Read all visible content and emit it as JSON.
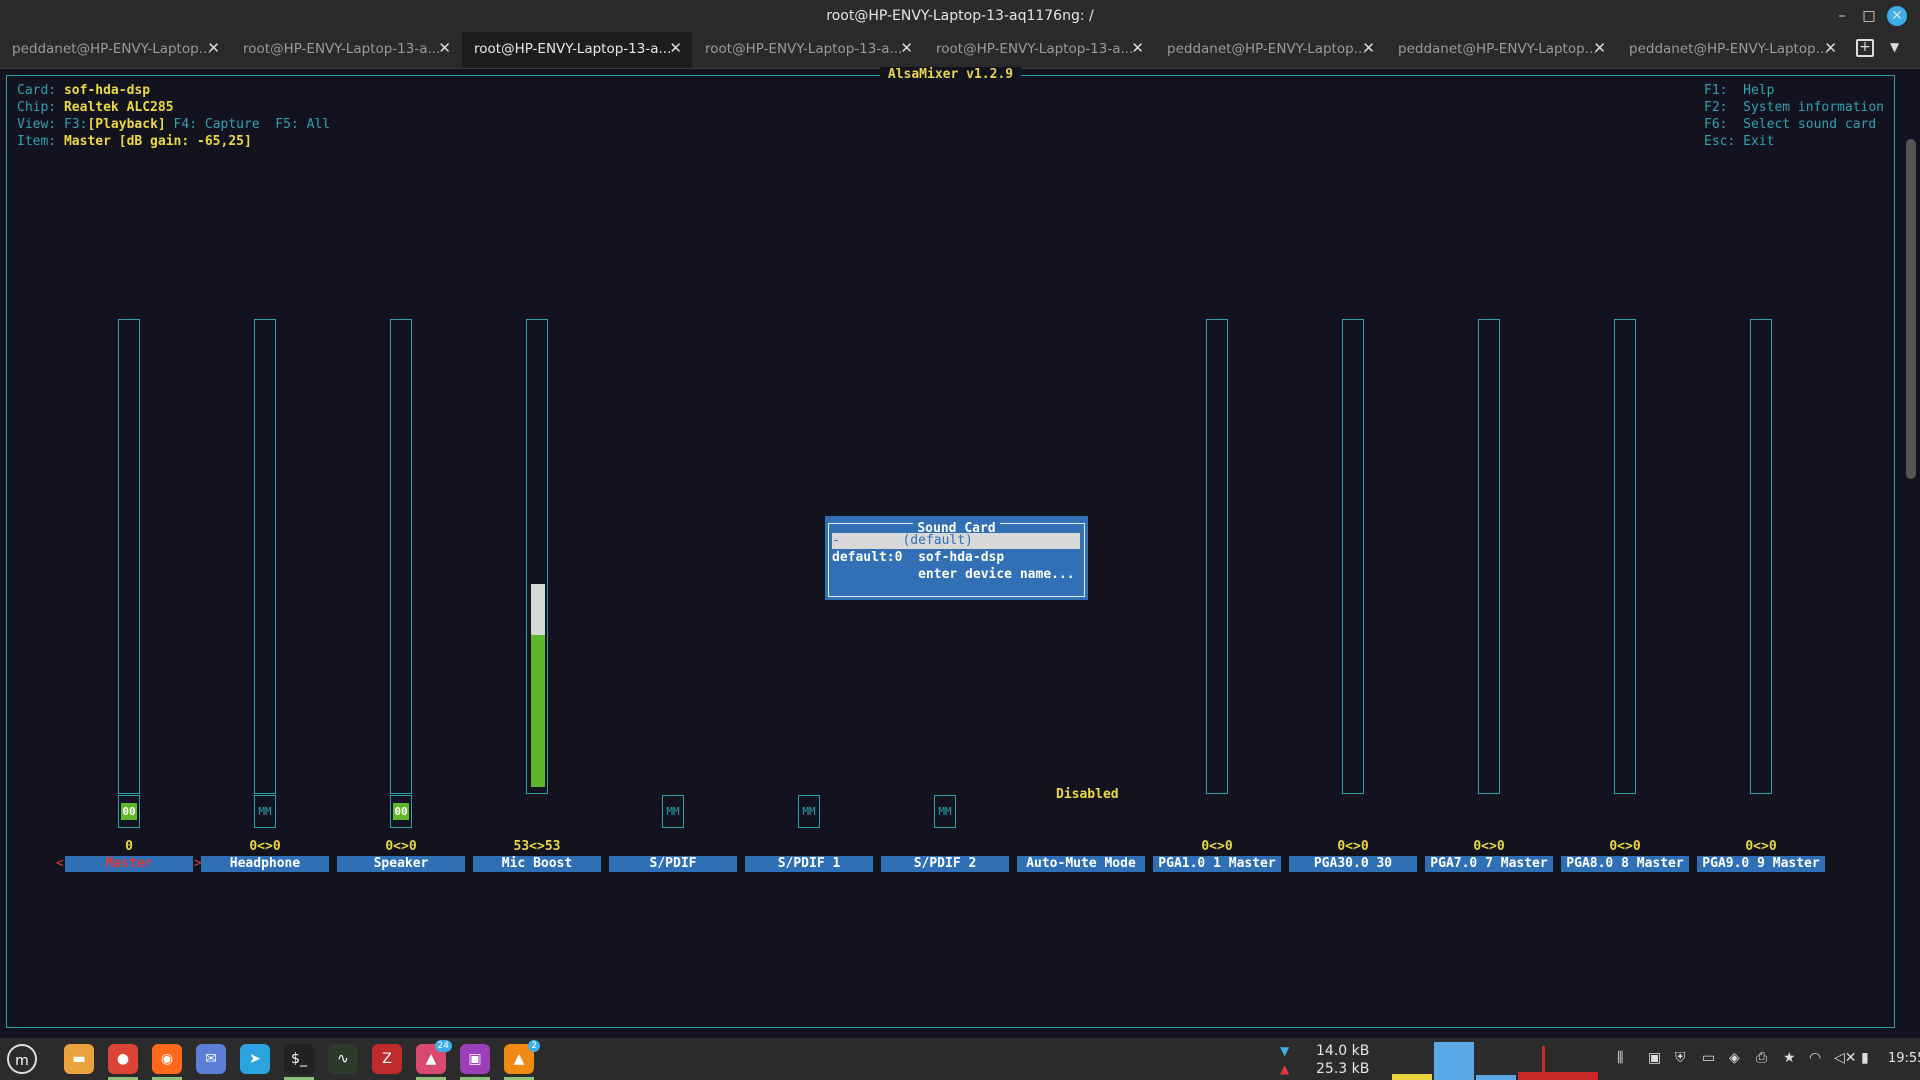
{
  "window": {
    "title": "root@HP-ENVY-Laptop-13-aq1176ng: /",
    "minimize_glyph": "–",
    "maximize_glyph": "□",
    "close_glyph": "✕"
  },
  "tabs": [
    {
      "label": "peddanet@HP-ENVY-Laptop...",
      "active": false
    },
    {
      "label": "root@HP-ENVY-Laptop-13-a...",
      "active": false
    },
    {
      "label": "root@HP-ENVY-Laptop-13-a...",
      "active": true
    },
    {
      "label": "root@HP-ENVY-Laptop-13-a...",
      "active": false
    },
    {
      "label": "root@HP-ENVY-Laptop-13-a...",
      "active": false
    },
    {
      "label": "peddanet@HP-ENVY-Laptop...",
      "active": false
    },
    {
      "label": "peddanet@HP-ENVY-Laptop...",
      "active": false
    },
    {
      "label": "peddanet@HP-ENVY-Laptop...",
      "active": false
    }
  ],
  "tab_close_glyph": "✕",
  "tab_new_glyph": "+",
  "tab_menu_glyph": "▼",
  "alsamixer": {
    "title": "AlsaMixer v1.2.9",
    "info": {
      "card_label": "Card:",
      "card_value": "sof-hda-dsp",
      "chip_label": "Chip:",
      "chip_value": "Realtek ALC285",
      "view_label": "View:",
      "view_f3": "F3:",
      "view_playback": "[Playback]",
      "view_rest": " F4: Capture  F5: All",
      "item_label": "Item:",
      "item_value": "Master [dB gain: -65,25]"
    },
    "keys": [
      "F1:  Help",
      "F2:  System information",
      "F6:  Select sound card",
      "Esc: Exit"
    ],
    "controls": [
      {
        "name": "Master",
        "value": "0",
        "mute": "00",
        "mute_on": true,
        "level": 0,
        "selected": true
      },
      {
        "name": "Headphone",
        "value": "0<>0",
        "mute": "MM",
        "mute_on": false,
        "level": 0,
        "selected": false
      },
      {
        "name": "Speaker",
        "value": "0<>0",
        "mute": "00",
        "mute_on": true,
        "level": 0,
        "selected": false
      },
      {
        "name": "Mic Boost",
        "value": "53<>53",
        "mute": "",
        "mute_on": false,
        "level": 0.53,
        "selected": false
      },
      {
        "name": "S/PDIF",
        "value": "",
        "mute": "MM",
        "mute_on": false,
        "level": null,
        "selected": false
      },
      {
        "name": "S/PDIF 1",
        "value": "",
        "mute": "MM",
        "mute_on": false,
        "level": null,
        "selected": false
      },
      {
        "name": "S/PDIF 2",
        "value": "",
        "mute": "MM",
        "mute_on": false,
        "level": null,
        "selected": false
      },
      {
        "name": "Auto-Mute Mode",
        "value": "",
        "mute": "",
        "mute_on": false,
        "level": null,
        "selected": false,
        "enum_value": "Disabled"
      },
      {
        "name": "PGA1.0 1 Master",
        "value": "0<>0",
        "mute": "",
        "mute_on": false,
        "level": 0,
        "selected": false
      },
      {
        "name": "PGA30.0 30",
        "value": "0<>0",
        "mute": "",
        "mute_on": false,
        "level": 0,
        "selected": false
      },
      {
        "name": "PGA7.0 7 Master",
        "value": "0<>0",
        "mute": "",
        "mute_on": false,
        "level": 0,
        "selected": false
      },
      {
        "name": "PGA8.0 8 Master",
        "value": "0<>0",
        "mute": "",
        "mute_on": false,
        "level": 0,
        "selected": false
      },
      {
        "name": "PGA9.0 9 Master",
        "value": "0<>0",
        "mute": "",
        "mute_on": false,
        "level": 0,
        "selected": false
      }
    ],
    "selection_left": "<",
    "selection_right": ">",
    "dialog": {
      "title": "Sound Card",
      "items": [
        {
          "text": "-        (default)",
          "highlighted": true
        },
        {
          "text": "default:0  sof-hda-dsp",
          "highlighted": false
        },
        {
          "text": "           enter device name...",
          "highlighted": false
        }
      ]
    }
  },
  "taskbar": {
    "apps": [
      {
        "icon": "files-icon",
        "glyph": "▬",
        "color": "#e8a33d",
        "running": false
      },
      {
        "icon": "chrome-icon",
        "glyph": "●",
        "color": "#db4437",
        "running": true
      },
      {
        "icon": "firefox-icon",
        "glyph": "◉",
        "color": "#ff6a1a",
        "running": true
      },
      {
        "icon": "mail-icon",
        "glyph": "✉",
        "color": "#5b7fd6",
        "running": false
      },
      {
        "icon": "telegram-icon",
        "glyph": "➤",
        "color": "#2aa3df",
        "running": false
      },
      {
        "icon": "terminal-icon",
        "glyph": "$_",
        "color": "#222222",
        "running": true
      },
      {
        "icon": "system-monitor-icon",
        "glyph": "∿",
        "color": "#2d3a2d",
        "running": false
      },
      {
        "icon": "filezilla-icon",
        "glyph": "Z",
        "color": "#bf2b2b",
        "running": false
      },
      {
        "icon": "photos-icon",
        "glyph": "▲",
        "color": "#d84a6d",
        "running": true,
        "badge": "24"
      },
      {
        "icon": "slides-icon",
        "glyph": "▣",
        "color": "#9a3fb8",
        "running": true
      },
      {
        "icon": "vlc-icon",
        "glyph": "▲",
        "color": "#f08a12",
        "running": true,
        "badge": "2"
      }
    ],
    "net_down": "14.0 kB",
    "net_up": "25.3 kB",
    "clock": "19:55"
  }
}
